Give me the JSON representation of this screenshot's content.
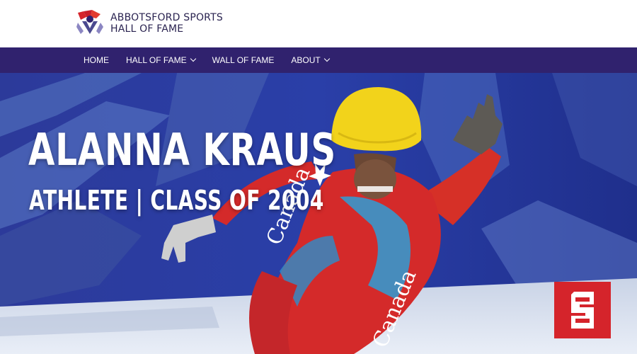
{
  "site": {
    "name_line1": "ABBOTSFORD SPORTS",
    "name_line2": "HALL OF FAME"
  },
  "nav": {
    "items": [
      {
        "label": "HOME",
        "dropdown": false
      },
      {
        "label": "HALL OF FAME",
        "dropdown": true
      },
      {
        "label": "WALL OF FAME",
        "dropdown": false
      },
      {
        "label": "ABOUT",
        "dropdown": true
      }
    ]
  },
  "hero": {
    "title": "ALANNA KRAUS",
    "subtitle": "ATHLETE | CLASS OF 2004",
    "suit_text": "Canada"
  },
  "badge": {
    "icon": "s-logo-icon",
    "color": "#d5242b"
  },
  "colors": {
    "nav_bg": "#30226e",
    "brand_text": "#2a2350",
    "helmet": "#f2d31b"
  }
}
